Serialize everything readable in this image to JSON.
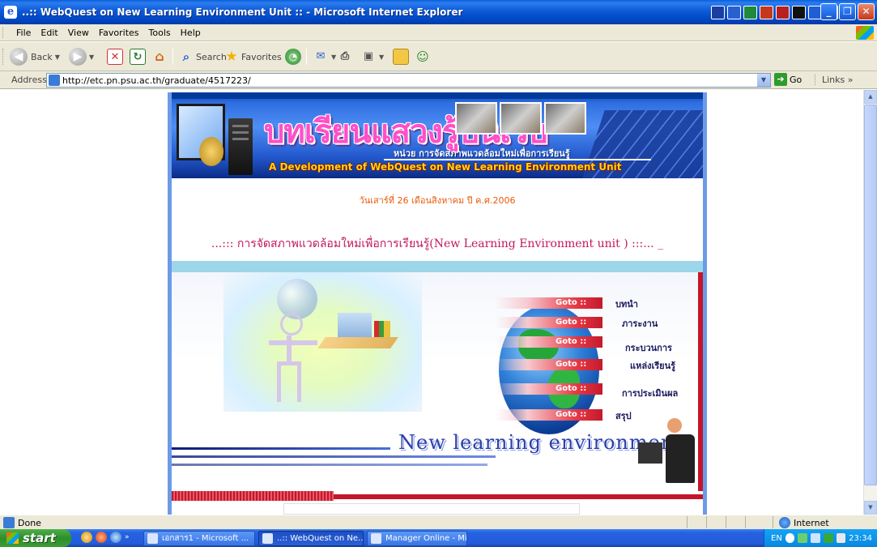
{
  "window": {
    "title": "..:: WebQuest on New Learning Environment Unit :: - Microsoft Internet Explorer",
    "minimize": "_",
    "maximize": "❐",
    "close": "✕"
  },
  "menu": {
    "items": [
      "File",
      "Edit",
      "View",
      "Favorites",
      "Tools",
      "Help"
    ]
  },
  "toolbar": {
    "back_label": "Back",
    "search_label": "Search",
    "favorites_label": "Favorites"
  },
  "address": {
    "label": "Address",
    "url": "http://etc.pn.psu.ac.th/graduate/4517223/",
    "go_label": "Go",
    "links_label": "Links"
  },
  "page": {
    "banner_thai_title": "บทเรียนแสวงรู้บนเว็บ",
    "banner_subtitle": "หน่วย การจัดสภาพแวดล้อมใหม่เพื่อการเรียนรู้",
    "banner_english_title": "A Development of WebQuest on New Learning Environment Unit",
    "date_text": "วันเสาร์ที่ 26 เดือนสิงหาคม ปี ค.ศ.2006",
    "headline": "...::: การจัดสภาพแวดล้อมใหม่เพื่อการเรียนรู้(New Learning Environment unit ) :::... _",
    "nav": [
      {
        "goto": "Goto  ::",
        "label": "บทนำ"
      },
      {
        "goto": "Goto  ::",
        "label": "ภาระงาน"
      },
      {
        "goto": "Goto  ::",
        "label": "กระบวนการ"
      },
      {
        "goto": "Goto  ::",
        "label": "แหล่งเรียนรู้"
      },
      {
        "goto": "Goto  ::",
        "label": "การประเมินผล"
      },
      {
        "goto": "Goto  ::",
        "label": "สรุป"
      }
    ],
    "banner_graphic_text": "New learning environment"
  },
  "status": {
    "text": "Done",
    "zone": "Internet"
  },
  "taskbar": {
    "start_label": "start",
    "tasks": [
      {
        "label": "เอกสาร1 - Microsoft ..."
      },
      {
        "label": "..:: WebQuest on Ne..."
      },
      {
        "label": "Manager Online - Micr..."
      }
    ],
    "lang": "EN",
    "clock": "23:34"
  },
  "colors": {
    "accent": "#0054e3",
    "nav_red": "#e63946",
    "date_orange": "#e85a0a",
    "headline_pink": "#c2185b"
  }
}
